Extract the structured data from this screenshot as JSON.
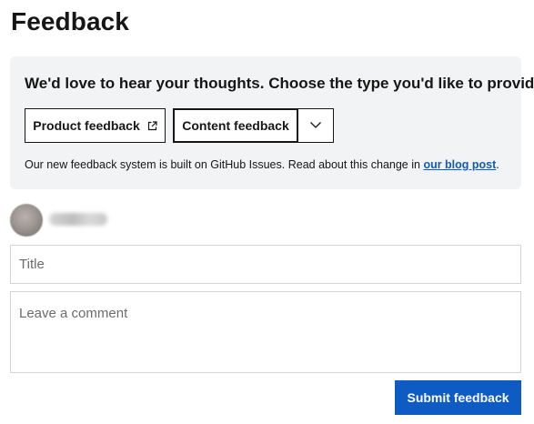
{
  "page": {
    "title": "Feedback"
  },
  "panel": {
    "prompt": "We'd love to hear your thoughts. Choose the type you'd like to provide:",
    "buttons": {
      "product_label": "Product feedback",
      "product_icon": "external-link-icon",
      "content_label": "Content feedback",
      "dropdown_icon": "chevron-down-icon"
    },
    "note_text": "Our new feedback system is built on GitHub Issues. Read about this change in ",
    "note_link": "our blog post",
    "note_end": "."
  },
  "form": {
    "title_placeholder": "Title",
    "comment_placeholder": "Leave a comment",
    "submit_label": "Submit feedback"
  },
  "colors": {
    "panel_bg": "#f2f3f5",
    "accent": "#0f5bc4",
    "link": "#0f5bb5"
  }
}
